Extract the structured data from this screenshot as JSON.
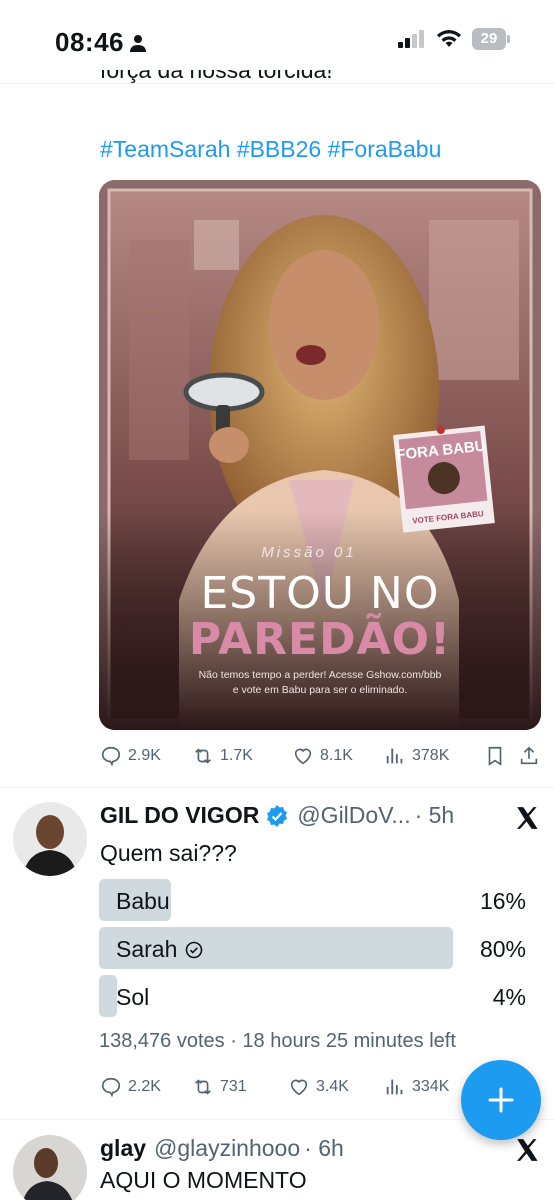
{
  "status_bar": {
    "time": "08:46",
    "battery": "29"
  },
  "tweet1": {
    "text_cut": "força da nossa torcida!",
    "hashtags": "#TeamSarah #BBB26 #ForaBabu",
    "image": {
      "mission": "Missão 01",
      "headline_line1": "ESTOU NO",
      "headline_line2": "PAREDÃO!",
      "sub_line1": "Não temos tempo a perder! Acesse Gshow.com/bbb",
      "sub_line2": "e vote em Babu para ser o eliminado.",
      "sticker_text": "FORA BABU",
      "sticker_caption": "VOTE FORA BABU"
    },
    "actions": {
      "replies": "2.9K",
      "reposts": "1.7K",
      "likes": "8.1K",
      "views": "378K"
    }
  },
  "tweet2": {
    "name": "GIL DO VIGOR",
    "handle": "@GilDoV...",
    "time": "· 5h",
    "text": "Quem sai???",
    "poll": {
      "options": [
        {
          "label": "Babu",
          "percent": "16%",
          "fraction": 0.16
        },
        {
          "label": "Sarah",
          "percent": "80%",
          "fraction": 0.8
        },
        {
          "label": "Sol",
          "percent": "4%",
          "fraction": 0.04
        }
      ],
      "votes": "138,476 votes",
      "time_left": "· 18 hours 25 minutes left"
    },
    "actions": {
      "replies": "2.2K",
      "reposts": "731",
      "likes": "3.4K",
      "views": "334K"
    }
  },
  "tweet3": {
    "name": "glay",
    "handle": "@glayzinhooo",
    "time": "· 6h",
    "text": "AQUI O MOMENTO"
  },
  "colors": {
    "accent": "#1d9bf0",
    "muted": "#536471",
    "poll_bar": "#cfd9de",
    "headline_pink": "#d98aa6"
  }
}
